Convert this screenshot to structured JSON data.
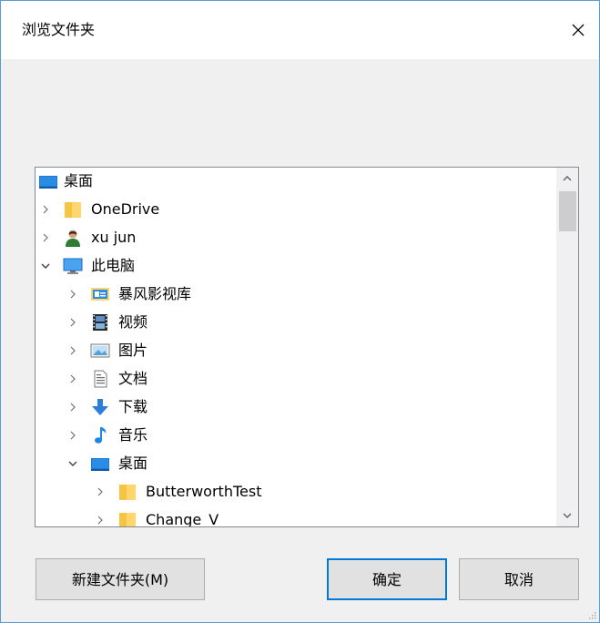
{
  "dialog": {
    "title": "浏览文件夹",
    "close_glyph": "✕"
  },
  "tree": {
    "items": [
      {
        "label": "桌面",
        "icon": "desktop-icon",
        "chevron": "none"
      },
      {
        "label": "OneDrive",
        "icon": "folder-icon",
        "chevron": "collapsed"
      },
      {
        "label": "xu jun",
        "icon": "user-icon",
        "chevron": "collapsed"
      },
      {
        "label": "此电脑",
        "icon": "computer-icon",
        "chevron": "expanded"
      },
      {
        "label": "暴风影视库",
        "icon": "media-library-icon",
        "chevron": "collapsed"
      },
      {
        "label": "视频",
        "icon": "video-icon",
        "chevron": "collapsed"
      },
      {
        "label": "图片",
        "icon": "pictures-icon",
        "chevron": "collapsed"
      },
      {
        "label": "文档",
        "icon": "documents-icon",
        "chevron": "collapsed"
      },
      {
        "label": "下载",
        "icon": "download-icon",
        "chevron": "collapsed"
      },
      {
        "label": "音乐",
        "icon": "music-icon",
        "chevron": "collapsed"
      },
      {
        "label": "桌面",
        "icon": "desktop-icon",
        "chevron": "expanded"
      },
      {
        "label": "ButterworthTest",
        "icon": "folder-icon",
        "chevron": "collapsed"
      },
      {
        "label": "Change_V",
        "icon": "folder-icon",
        "chevron": "collapsed"
      }
    ]
  },
  "buttons": {
    "new_folder": "新建文件夹(M)",
    "ok": "确定",
    "cancel": "取消"
  },
  "colors": {
    "accent": "#0078d7",
    "border": "#5b9bd5",
    "folder": "#ffd66b"
  }
}
